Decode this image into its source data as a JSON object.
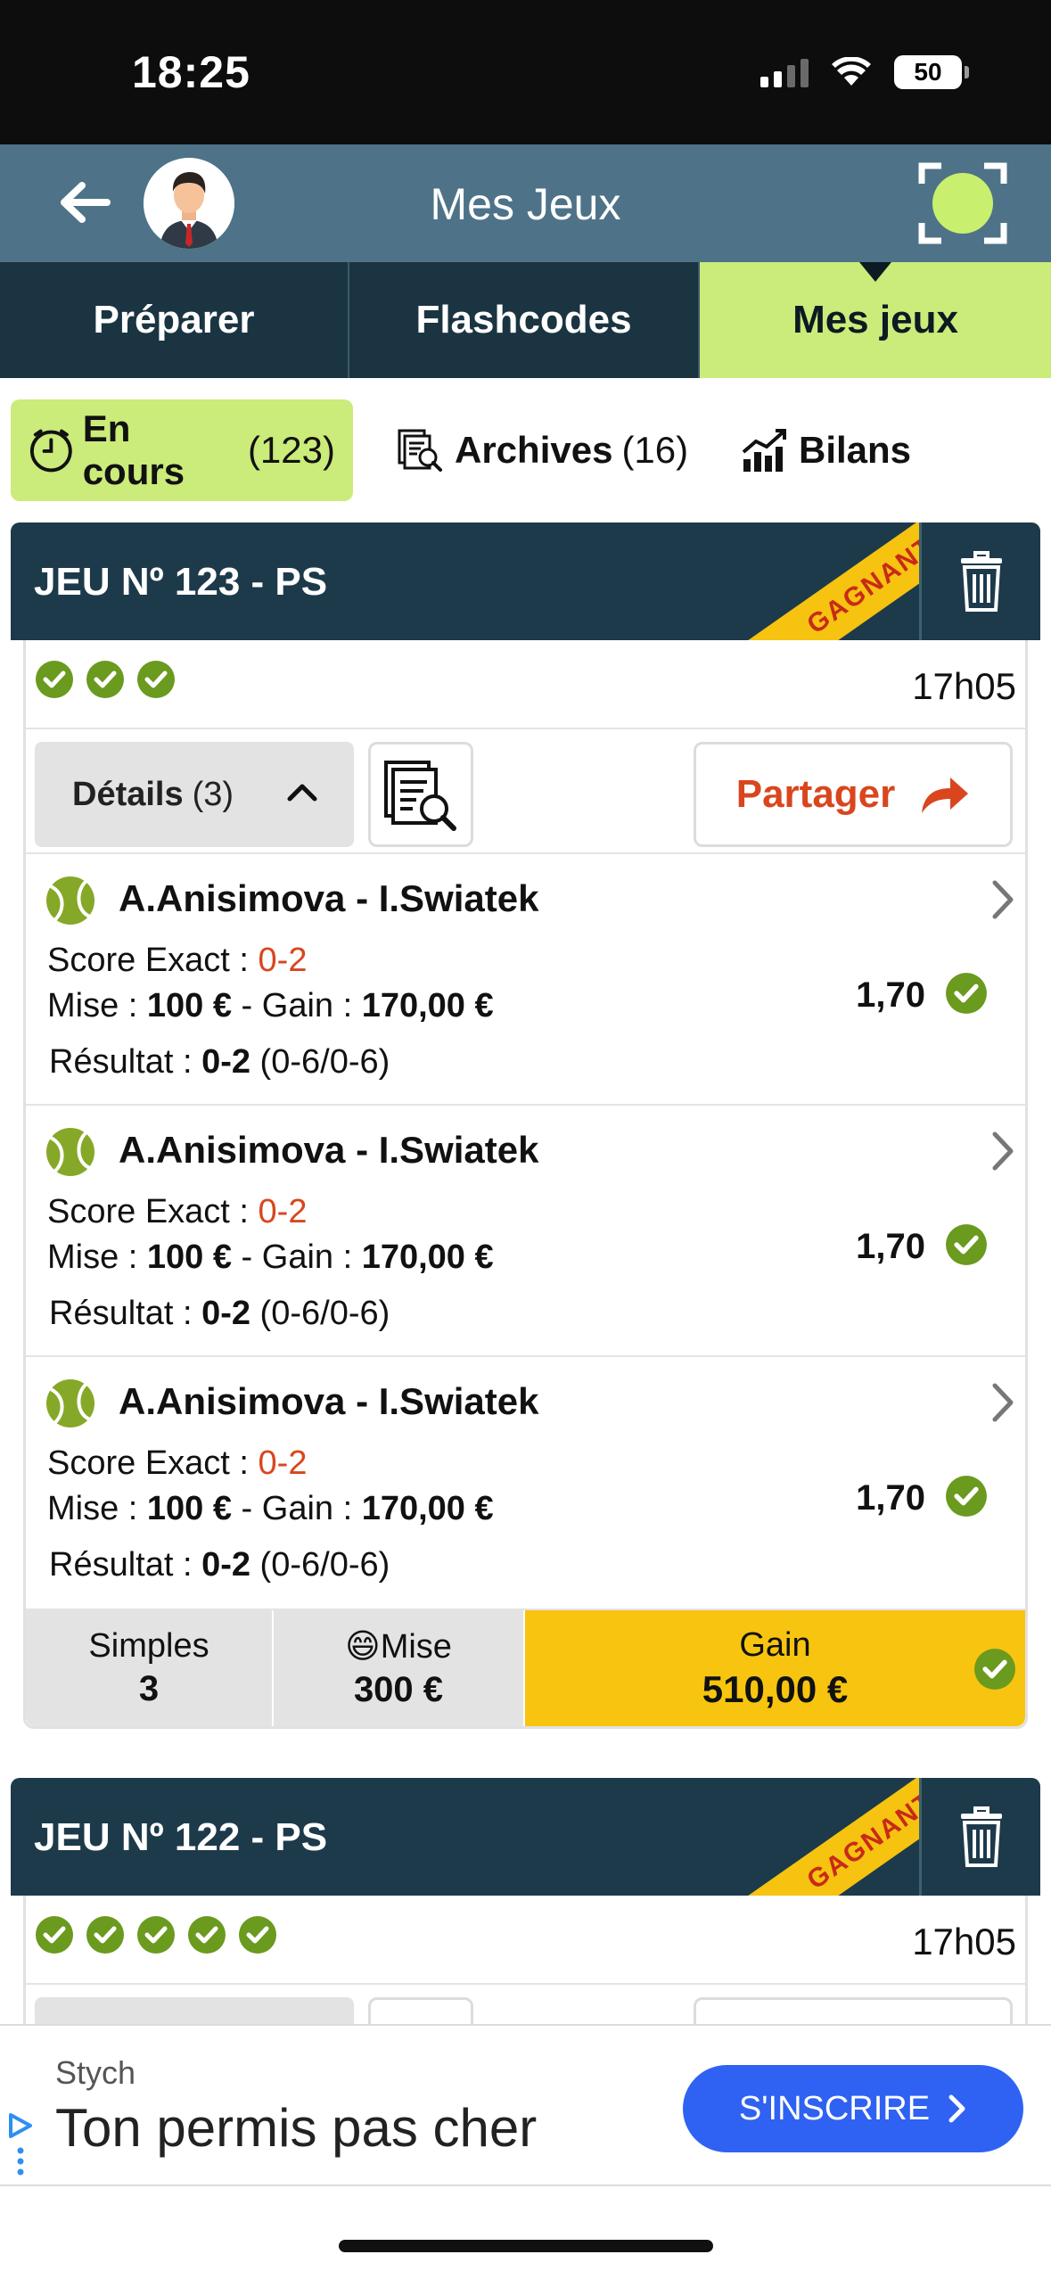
{
  "status_bar": {
    "time": "18:25",
    "battery": "50"
  },
  "header": {
    "title": "Mes Jeux"
  },
  "main_tabs": [
    {
      "label": "Préparer"
    },
    {
      "label": "Flashcodes"
    },
    {
      "label": "Mes jeux"
    }
  ],
  "sub_tabs": {
    "current": {
      "label": "En cours",
      "count": "(123)"
    },
    "archives": {
      "label": "Archives",
      "count": "(16)"
    },
    "bilans": {
      "label": "Bilans"
    }
  },
  "cards": [
    {
      "title": "JEU Nº 123 - PS",
      "ribbon": "GAGNANT",
      "check_count": 3,
      "time": "17h05",
      "details_label": "Détails",
      "details_count": "(3)",
      "share_label": "Partager",
      "bets": [
        {
          "match": "A.Anisimova - I.Swiatek",
          "score_label": "Score Exact : ",
          "score": "0-2",
          "mise_label": "Mise : ",
          "mise": "100 €",
          "gain_label": " - Gain : ",
          "gain": "170,00 €",
          "result_label": "Résultat : ",
          "result": "0-2",
          "result_detail": " (0-6/0-6)",
          "odds": "1,70"
        },
        {
          "match": "A.Anisimova - I.Swiatek",
          "score_label": "Score Exact : ",
          "score": "0-2",
          "mise_label": "Mise : ",
          "mise": "100 €",
          "gain_label": " - Gain : ",
          "gain": "170,00 €",
          "result_label": "Résultat : ",
          "result": "0-2",
          "result_detail": " (0-6/0-6)",
          "odds": "1,70"
        },
        {
          "match": "A.Anisimova - I.Swiatek",
          "score_label": "Score Exact : ",
          "score": "0-2",
          "mise_label": "Mise : ",
          "mise": "100 €",
          "gain_label": " - Gain : ",
          "gain": "170,00 €",
          "result_label": "Résultat : ",
          "result": "0-2",
          "result_detail": " (0-6/0-6)",
          "odds": "1,70"
        }
      ],
      "summary": {
        "simples_label": "Simples",
        "simples_value": "3",
        "mise_label": "Mise",
        "mise_value": "300 €",
        "gain_label": "Gain",
        "gain_value": "510,00 €"
      }
    },
    {
      "title": "JEU Nº 122 - PS",
      "ribbon": "GAGNANT",
      "check_count": 5,
      "time": "17h05"
    }
  ],
  "ad": {
    "sponsor": "Stych",
    "headline": "Ton permis pas cher",
    "cta": "S'INSCRIRE"
  },
  "colors": {
    "header": "#4e7388",
    "tabbar": "#1b3441",
    "accent_green": "#cbeb7a",
    "card_header": "#1d3a4b",
    "ribbon": "#f5c310",
    "ok_green": "#6a9a1e",
    "highlight_orange": "#d9461e",
    "cta_blue": "#2f62f2"
  }
}
